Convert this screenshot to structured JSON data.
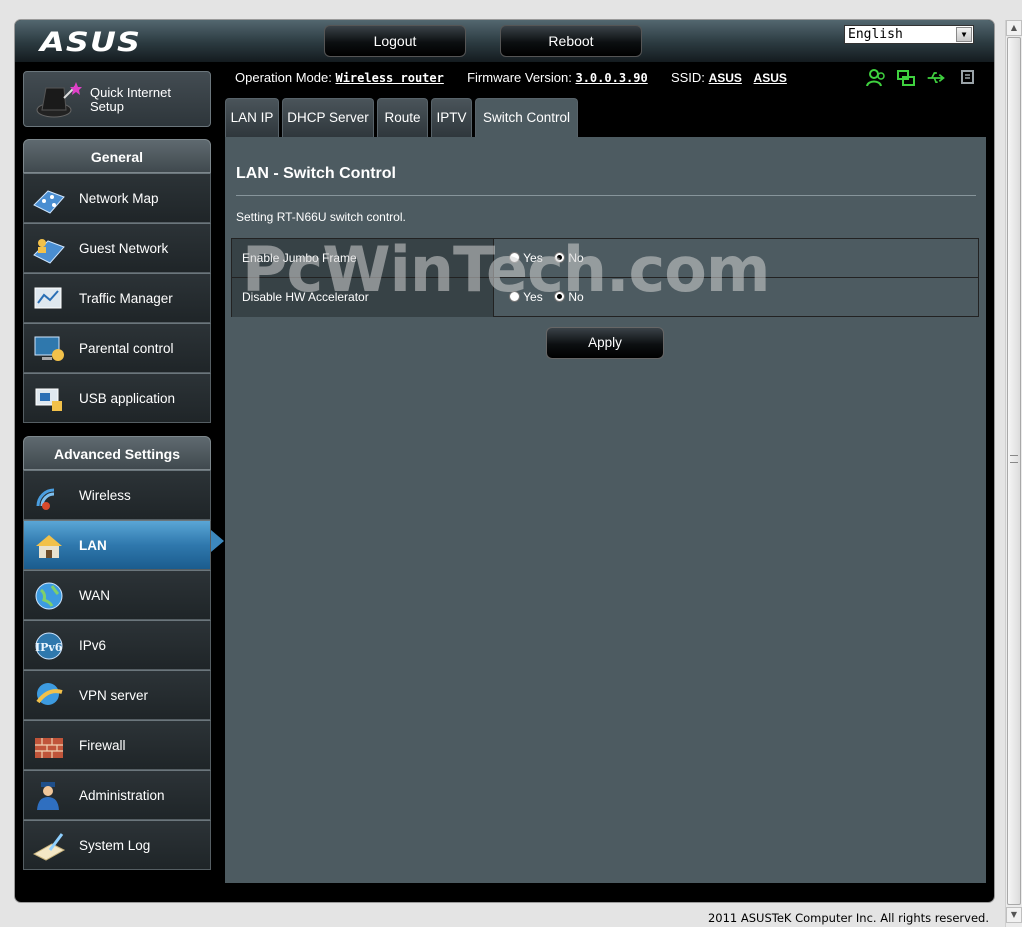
{
  "header": {
    "logo": "ASUS",
    "logout_label": "Logout",
    "reboot_label": "Reboot",
    "language": "English"
  },
  "status": {
    "op_mode_label": "Operation Mode:",
    "op_mode_value": "Wireless router",
    "firmware_label": "Firmware Version:",
    "firmware_value": "3.0.0.3.90",
    "ssid_label": "SSID:",
    "ssid_values": [
      "ASUS",
      "ASUS"
    ]
  },
  "sidebar": {
    "quick_setup": "Quick Internet Setup",
    "quick_setup_line1": "Quick Internet",
    "quick_setup_line2": "Setup",
    "general_header": "General",
    "general_items": [
      {
        "label": "Network Map",
        "icon": "network-map-icon"
      },
      {
        "label": "Guest Network",
        "icon": "guest-network-icon"
      },
      {
        "label": "Traffic Manager",
        "icon": "traffic-manager-icon"
      },
      {
        "label": "Parental control",
        "icon": "parental-control-icon"
      },
      {
        "label": "USB application",
        "icon": "usb-application-icon"
      }
    ],
    "advanced_header": "Advanced Settings",
    "advanced_items": [
      {
        "label": "Wireless",
        "icon": "wireless-icon"
      },
      {
        "label": "LAN",
        "icon": "lan-icon",
        "active": true
      },
      {
        "label": "WAN",
        "icon": "wan-globe-icon"
      },
      {
        "label": "IPv6",
        "icon": "ipv6-icon"
      },
      {
        "label": "VPN server",
        "icon": "vpn-server-icon"
      },
      {
        "label": "Firewall",
        "icon": "firewall-icon"
      },
      {
        "label": "Administration",
        "icon": "administration-icon"
      },
      {
        "label": "System Log",
        "icon": "system-log-icon"
      }
    ]
  },
  "tabs": [
    {
      "label": "LAN IP"
    },
    {
      "label": "DHCP Server"
    },
    {
      "label": "Route"
    },
    {
      "label": "IPTV"
    },
    {
      "label": "Switch Control",
      "active": true
    }
  ],
  "main": {
    "title": "LAN - Switch Control",
    "description": "Setting RT-N66U switch control.",
    "settings": [
      {
        "label": "Enable Jumbo Frame",
        "options": [
          "Yes",
          "No"
        ],
        "selected": "No"
      },
      {
        "label": "Disable HW Accelerator",
        "options": [
          "Yes",
          "No"
        ],
        "selected": "No"
      }
    ],
    "apply_label": "Apply"
  },
  "watermark": "PcWinTech.com",
  "footer": "2011 ASUSTeK Computer Inc. All rights reserved.",
  "colors": {
    "accent_green": "#3fd13f",
    "active_blue": "#2f78ad",
    "content_bg": "#4d5b61"
  }
}
